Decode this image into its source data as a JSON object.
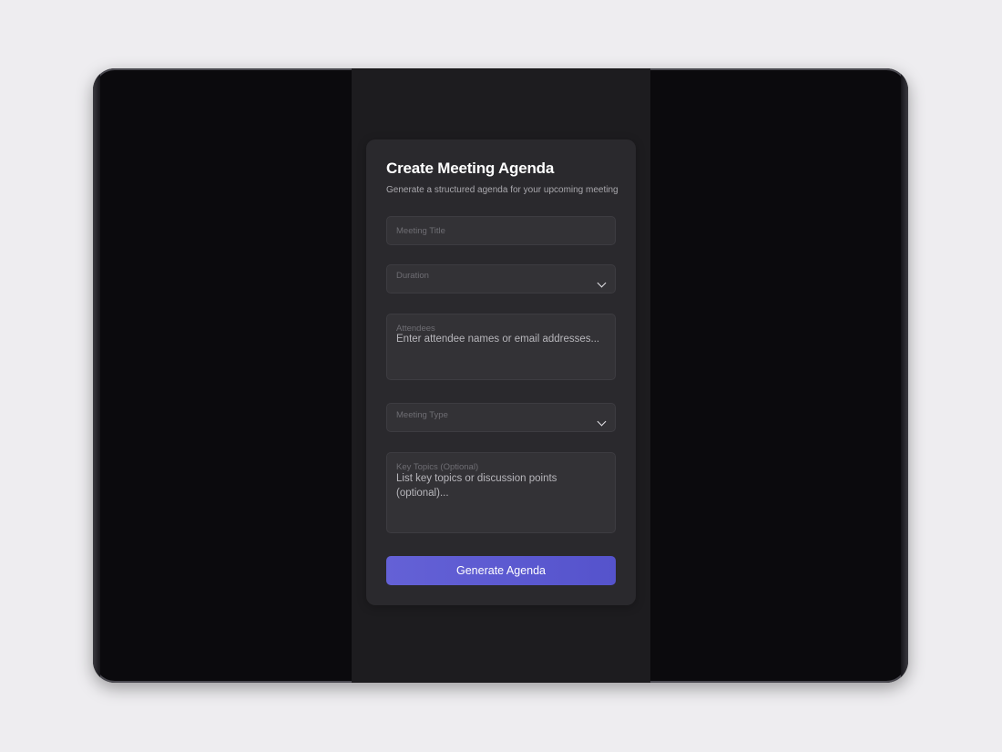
{
  "form": {
    "title": "Create Meeting Agenda",
    "subtitle": "Generate a structured agenda for your upcoming meeting",
    "meeting_title": {
      "label": "Meeting Title"
    },
    "duration": {
      "label": "Duration",
      "icon": "chevron-down-icon"
    },
    "attendees": {
      "label": "Attendees",
      "placeholder": "Enter attendee names or email addresses..."
    },
    "meeting_type": {
      "label": "Meeting Type",
      "icon": "chevron-down-icon"
    },
    "key_topics": {
      "label": "Key Topics (Optional)",
      "placeholder": "List key topics or discussion points (optional)..."
    },
    "submit_label": "Generate Agenda"
  },
  "colors": {
    "page_background": "#eeedf0",
    "app_background": "#1d1c1f",
    "card_background": "#2a292d",
    "field_background": "#333236",
    "accent": "#5f5dd4"
  }
}
